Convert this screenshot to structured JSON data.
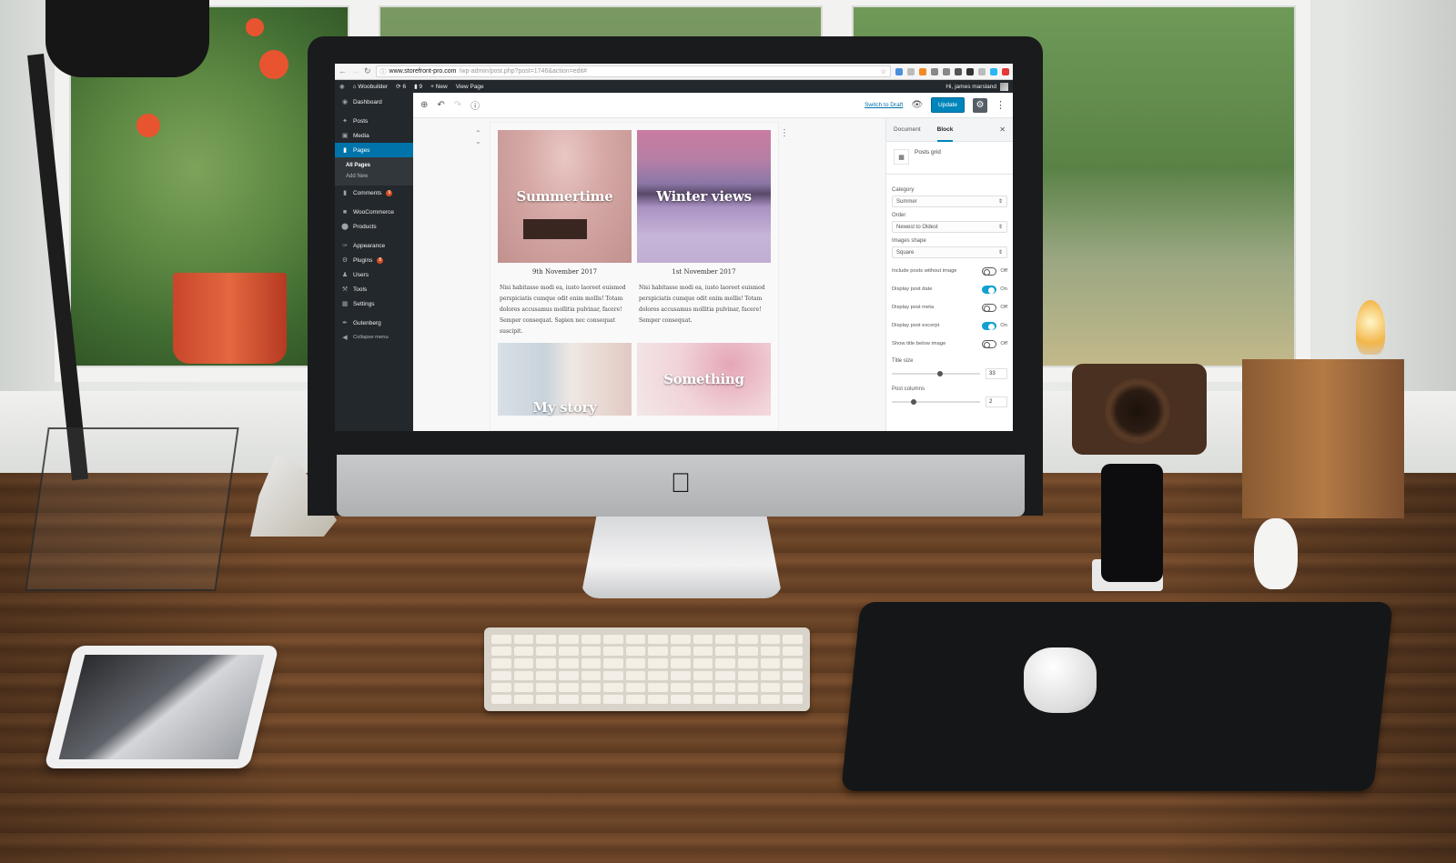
{
  "browser": {
    "url_host": "www.storefront-pro.com",
    "url_path": "/wp-admin/post.php?post=1746&action=edit#",
    "nav": [
      "back-icon",
      "forward-icon",
      "reload-icon",
      "info-icon"
    ],
    "extension_colors": [
      "#4a90d9",
      "#bbbbbb",
      "#f08a24",
      "#888888",
      "#888888",
      "#555555",
      "#333333",
      "#bbbbbb",
      "#29b6f6",
      "#e53935"
    ]
  },
  "admin_bar": {
    "site_name": "Woobuilder",
    "updates_count": "6",
    "comments_count": "9",
    "new_label": "New",
    "view_page_label": "View Page",
    "greeting": "Hi, james marsland"
  },
  "sidebar": {
    "items": [
      {
        "label": "Dashboard",
        "icon": "dashboard-icon"
      },
      {
        "label": "Posts",
        "icon": "pin-icon"
      },
      {
        "label": "Media",
        "icon": "media-icon"
      },
      {
        "label": "Pages",
        "icon": "page-icon",
        "active": true
      },
      {
        "label": "Comments",
        "icon": "comment-icon",
        "badge": "9"
      },
      {
        "label": "WooCommerce",
        "icon": "woo-icon"
      },
      {
        "label": "Products",
        "icon": "products-icon"
      },
      {
        "label": "Appearance",
        "icon": "brush-icon"
      },
      {
        "label": "Plugins",
        "icon": "plugin-icon",
        "badge": "8"
      },
      {
        "label": "Users",
        "icon": "users-icon"
      },
      {
        "label": "Tools",
        "icon": "wrench-icon"
      },
      {
        "label": "Settings",
        "icon": "settings-icon"
      },
      {
        "label": "Gutenberg",
        "icon": "pen-icon"
      },
      {
        "label": "Collapse menu",
        "icon": "collapse-icon"
      }
    ],
    "pages_submenu": [
      "All Pages",
      "Add New"
    ]
  },
  "toolbar": {
    "switch_to_draft": "Switch to Draft",
    "update": "Update"
  },
  "posts": [
    {
      "title": "Summertime",
      "date": "9th November 2017",
      "excerpt": "Nisi habitasse modi ea, iusto laoreet euismod perspiciatis cumque odit enim mollis! Totam dolores accusamus mollitia pulvinar, facere! Semper consequat. Sapien nec consequat suscipit."
    },
    {
      "title": "Winter views",
      "date": "1st November 2017",
      "excerpt": "Nisi habitasse modi ea, iusto laoreet euismod perspiciatis cumque odit enim mollis! Totam dolores accusamus mollitia pulvinar, facere! Semper consequat."
    },
    {
      "title": "My story"
    },
    {
      "title": "Something"
    }
  ],
  "inspector": {
    "tabs": [
      "Document",
      "Block"
    ],
    "active_tab": "Block",
    "block_name": "Posts grid",
    "category_label": "Category",
    "category_value": "Summer",
    "order_label": "Order",
    "order_value": "Newest to Oldest",
    "shape_label": "Images shape",
    "shape_value": "Square",
    "toggles": [
      {
        "label": "Include posts without image",
        "state": "Off",
        "on": false
      },
      {
        "label": "Display post date",
        "state": "On",
        "on": true
      },
      {
        "label": "Display post meta",
        "state": "Off",
        "on": false
      },
      {
        "label": "Display post excerpt",
        "state": "On",
        "on": true
      },
      {
        "label": "Show title below image",
        "state": "Off",
        "on": false
      }
    ],
    "title_size_label": "Title size",
    "title_size_value": "33",
    "title_size_fraction": 0.55,
    "post_columns_label": "Post columns",
    "post_columns_value": "2",
    "post_columns_fraction": 0.25
  }
}
